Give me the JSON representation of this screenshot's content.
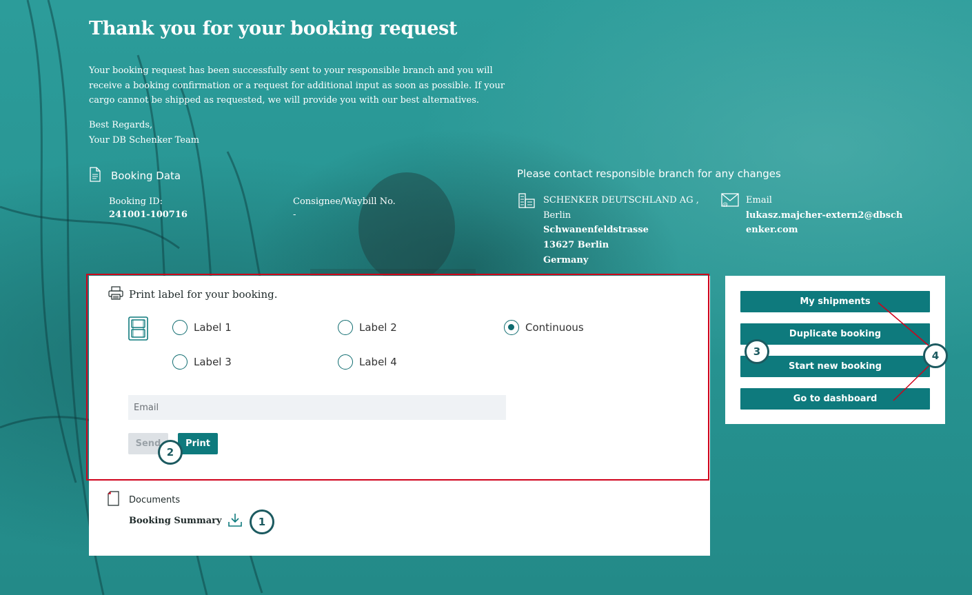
{
  "page": {
    "title": "Thank you for your booking request",
    "intro": "Your booking request has been successfully sent to your responsible branch and you will receive a booking confirmation or a request for additional input as soon as possible. If your cargo cannot be shipped as requested, we will provide you with our best alternatives.",
    "regards_line1": "Best Regards,",
    "regards_line2": "Your DB Schenker Team"
  },
  "booking_data": {
    "heading": "Booking Data",
    "id_label": "Booking ID:",
    "id_value": "241001-100716",
    "consignee_label": "Consignee/Waybill No.",
    "consignee_value": "-"
  },
  "contact": {
    "heading": "Please contact responsible branch for any changes",
    "branch_name": "SCHENKER DEUTSCHLAND AG ,",
    "branch_city": "Berlin",
    "street": "Schwanenfeldstrasse",
    "postal": "13627 Berlin",
    "country": "Germany",
    "email_label": "Email",
    "email_value": "lukasz.majcher-extern2@dbschenker.com"
  },
  "print_label": {
    "heading": "Print label for your booking.",
    "options": [
      "Label 1",
      "Label 2",
      "Continuous",
      "Label 3",
      "Label 4"
    ],
    "selected": "Continuous",
    "email_placeholder": "Email",
    "send_label": "Send",
    "print_label": "Print"
  },
  "documents": {
    "heading": "Documents",
    "booking_summary": "Booking Summary"
  },
  "actions": {
    "my_shipments": "My shipments",
    "duplicate_booking": "Duplicate booking",
    "start_new_booking": "Start new booking",
    "go_to_dashboard": "Go to dashboard"
  },
  "callouts": {
    "c1": "1",
    "c2": "2",
    "c3": "3",
    "c4": "4",
    "highlight_color": "#d0021b"
  },
  "colors": {
    "primary": "#0e7a7d",
    "background": "#2a9a98",
    "callout_border": "#1c5a60"
  },
  "icons": [
    "document-icon",
    "building-icon",
    "mail-icon",
    "printer-icon",
    "label-sheet-icon",
    "pdf-file-icon",
    "download-icon"
  ]
}
